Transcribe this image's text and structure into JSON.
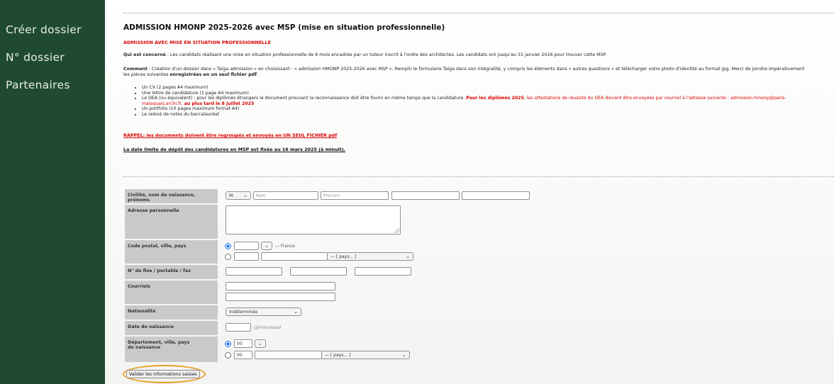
{
  "sidebar": {
    "items": [
      {
        "label": "Créer dossier"
      },
      {
        "label": "N° dossier"
      },
      {
        "label": "Partenaires"
      }
    ]
  },
  "header": {
    "title": "ADMISSION HMONP 2025-2026 avec MSP (mise en situation professionnelle)",
    "subtitle": "ADMISSION AVEC MISE EN SITUATION PROFESSIONNELLE"
  },
  "intro": {
    "concern_label": "Qui est concerné",
    "concern_text": " : Les candidats réalisant une mise en situation professionnelle de 6 mois encadrée par un tuteur inscrit à l'ordre des architectes. Les candidats ont jusqu'au 31 janvier 2026 pour trouver cette MSP.",
    "comment_label": "Comment",
    "comment_text": " : Création d'un dossier dans « Taïga admission » en choisissant : « admission HMONP 2025-2026 avec MSP ». Remplir le formulaire Taïga dans son intégralité, y compris les éléments dans « autres questions » et télécharger votre photo d'identité au format jpg. Merci de joindre impérativement",
    "comment_text2": "les pièces suivantes ",
    "comment_bold": "enregistrées en un seul fichier pdf",
    "comment_end": ":"
  },
  "requirements": {
    "cv": "Un CV (2 pages A4 maximum)",
    "letter": "Une lettre de candidature (1 page A4 maximum)",
    "dea_a": "Le DEA (ou équivalent) : pour les diplômés étrangers le document prouvant la reconnaissance doit être fourni en même temps que la candidature. ",
    "dea_b": "Pour les diplômés 2025",
    "dea_c": ", les attestations de réussite du DEA doivent être envoyées par courriel à l'adresse suivante : admission.hmonp@paris-",
    "dea_d": "malaquais.archi.fr, ",
    "dea_e": "au plus tard le 8 juillet 2025",
    "portfolio": "Un portfolio (10 pages maximum format A4)",
    "bac": "Le relevé de notes du baccalauréat"
  },
  "rappel": "RAPPEL: les documents doivent être regroupés et envoyés en UN SEUL FICHIER pdf",
  "deadline": {
    "a": "La date limite de dépôt des candidatures en MSP est fixée au ",
    "b": "16 mars 2025",
    "c": " (à minuit)."
  },
  "form": {
    "civility": {
      "label": "Civilité, nom de naissance, prénoms",
      "selected": "M.",
      "nom_placeholder": "Nom",
      "prenom_placeholder": "Prénom"
    },
    "address": {
      "label": "Adresse personnelle"
    },
    "postal": {
      "label": "Code postal, ville, pays",
      "country_fixed": "— France",
      "country_select": "— [ pays... ]"
    },
    "phones": {
      "label": "N° de fixe / portable / fax"
    },
    "emails": {
      "label": "Courriels"
    },
    "nationality": {
      "label": "Nationalité",
      "selected": "Indéterminée"
    },
    "birthdate": {
      "label": "Date de naissance",
      "hint": "(jj/mm/aaaa)"
    },
    "birthplace": {
      "label_line1": "Département, ville, pays",
      "label_line2": "de naissance",
      "dept_value": "00",
      "dept_value2": "00",
      "country_select": "— [ pays... ]"
    },
    "submit_label": "Valider les informations saisies"
  },
  "colors": {
    "sidebar": "#1f4a31",
    "accent_red": "#d80000",
    "highlight_ring": "#e8a028",
    "label_bg": "#c9c9c9"
  },
  "icons": {
    "select_arrow": "chevron-down-icon",
    "resize": "resize-grip-icon"
  }
}
